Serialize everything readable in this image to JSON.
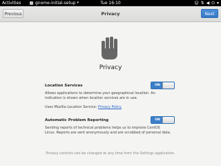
{
  "topbar": {
    "activities": "Activities",
    "app_name": "gnome-initial-setup",
    "clock": "Tue 16:10",
    "icons": [
      "accessibility-icon",
      "network-icon",
      "volume-icon",
      "power-icon"
    ]
  },
  "header": {
    "previous_label": "Previous",
    "title": "Privacy",
    "next_label": "Next"
  },
  "main": {
    "icon": "privacy-hand-icon",
    "title": "Privacy",
    "location": {
      "label": "Location Services",
      "toggle_label": "ON",
      "description_lines": [
        "Allows applications to determine your geographical location. An",
        "indication is shown when location services are in use."
      ],
      "uses_text": "Uses Mozilla Location Service: ",
      "policy_link": "Privacy Policy"
    },
    "reporting": {
      "label": "Automatic Problem Reporting",
      "toggle_label": "ON",
      "description_lines": [
        "Sending reports of technical problems helps us to improve CentOS",
        "Linux. Reports are sent anonymously and are scrubbed of personal data."
      ]
    },
    "footer": "Privacy controls can be changed at any time from the Settings application."
  },
  "colors": {
    "accent": "#3b7fc9",
    "topbar": "#000000",
    "background": "#f4f4f3"
  }
}
